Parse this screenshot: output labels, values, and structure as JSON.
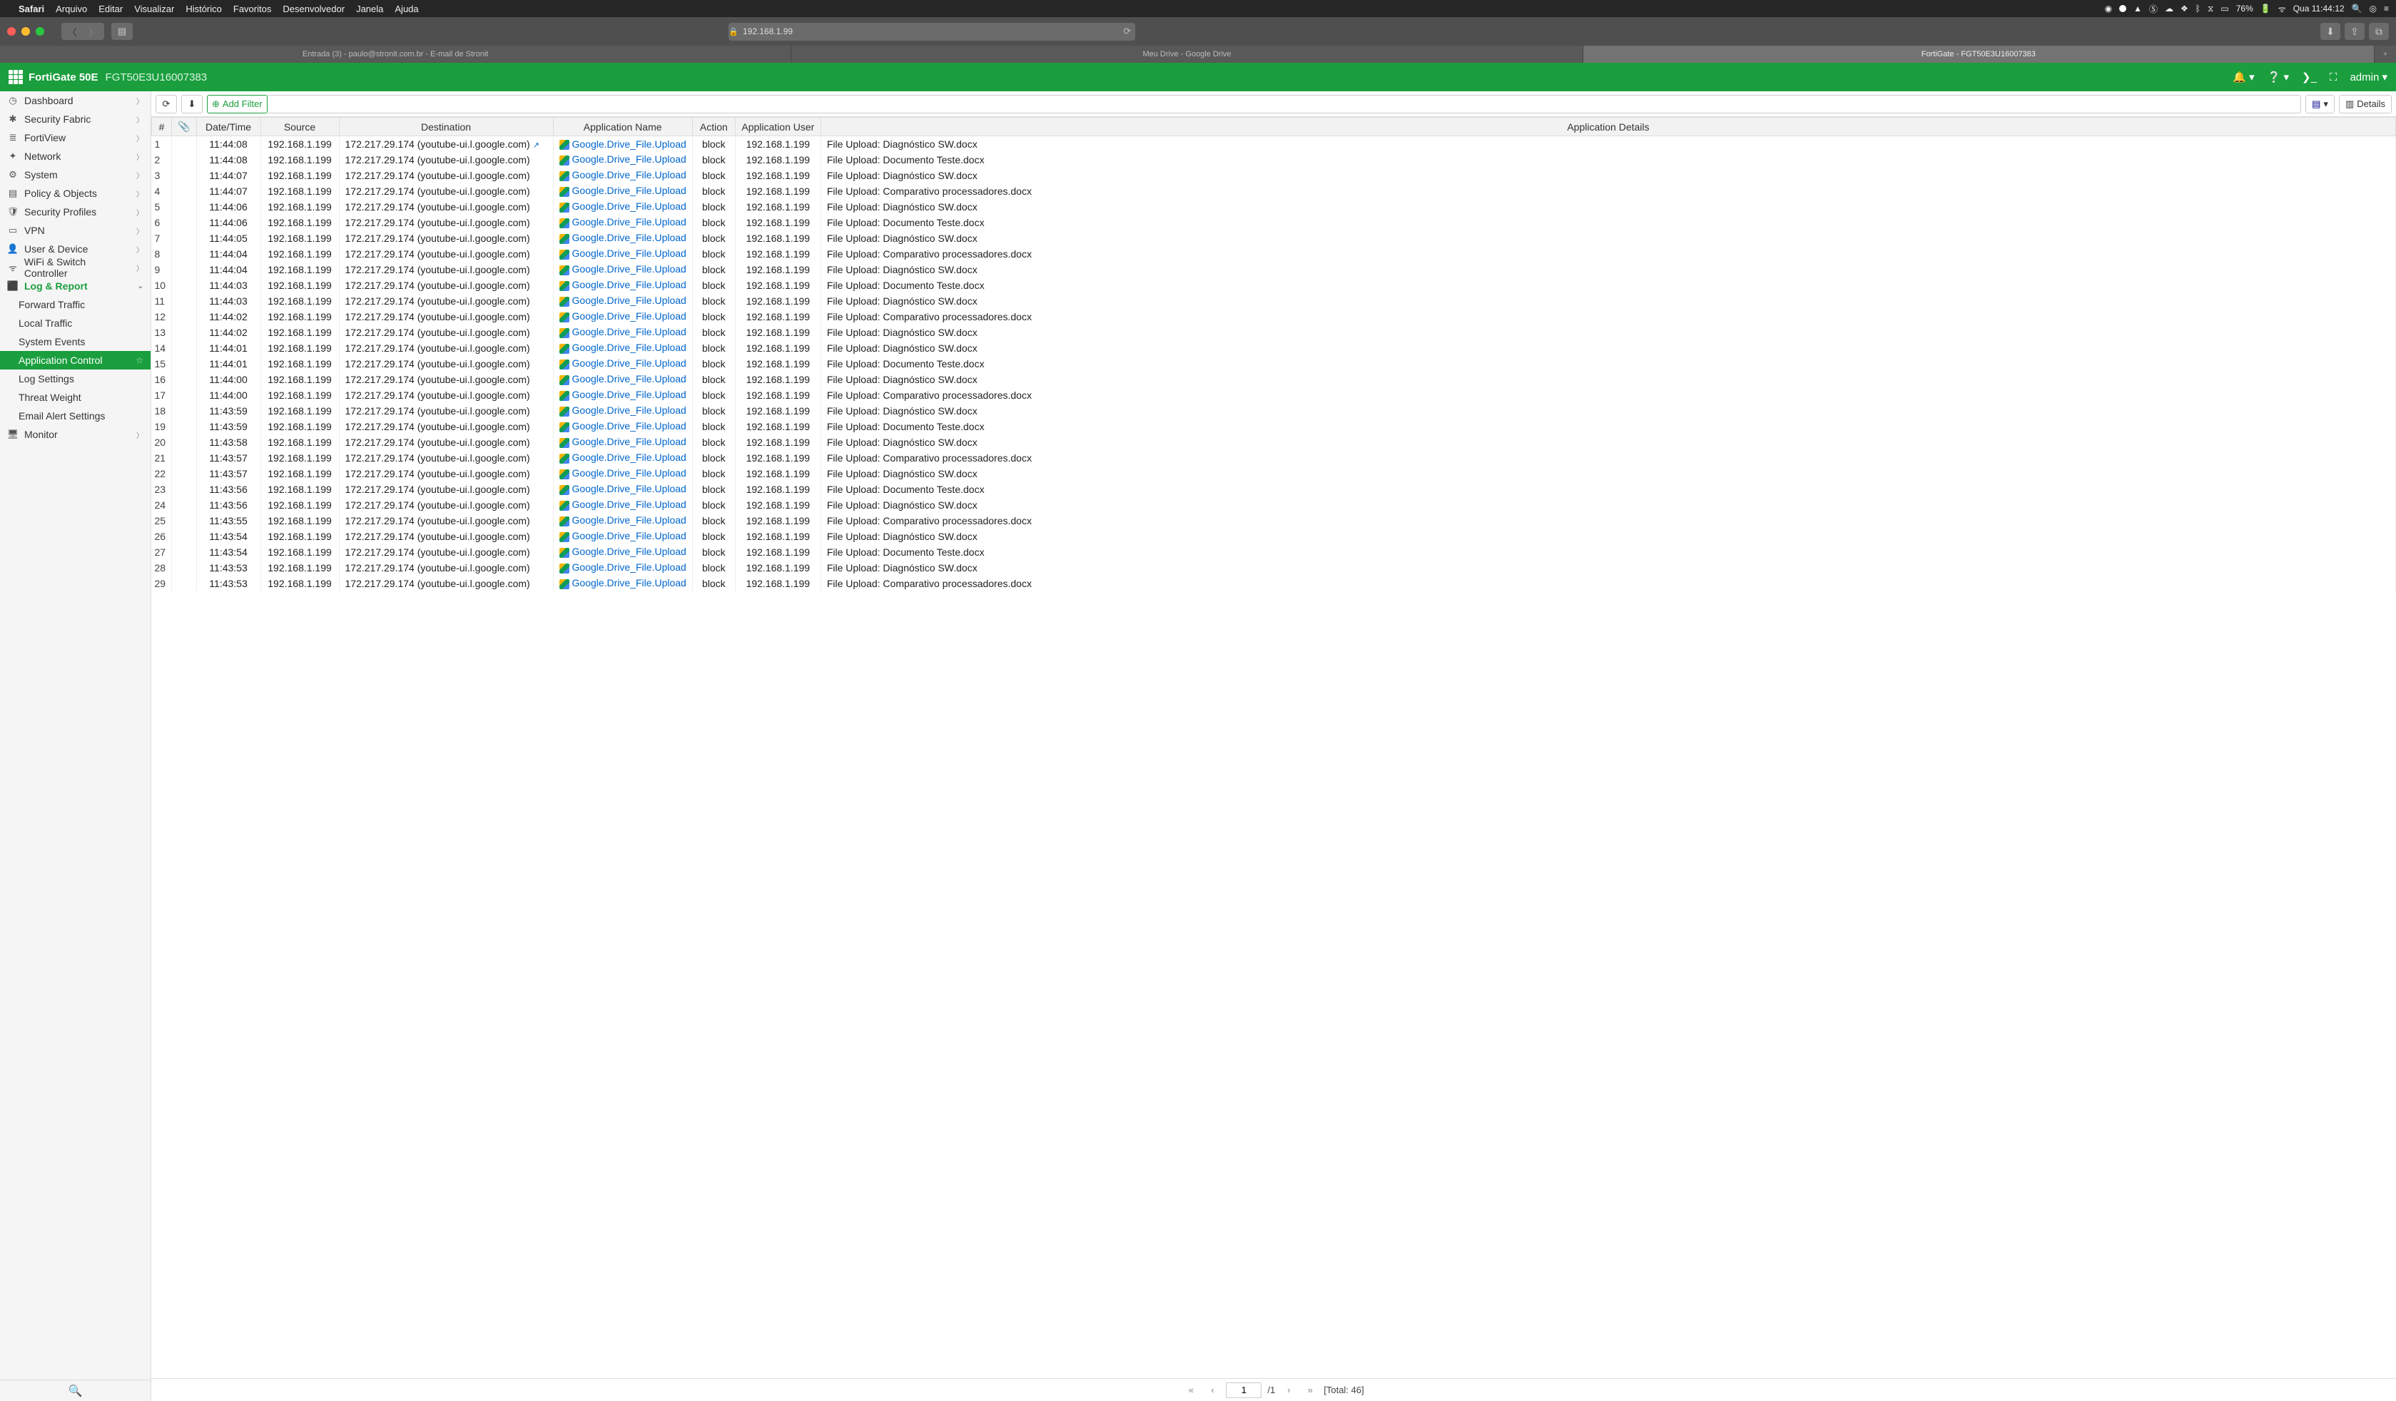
{
  "mac_menu": {
    "app": "Safari",
    "items": [
      "Arquivo",
      "Editar",
      "Visualizar",
      "Histórico",
      "Favoritos",
      "Desenvolvedor",
      "Janela",
      "Ajuda"
    ],
    "battery": "76%",
    "clock": "Qua 11:44:12"
  },
  "url": "192.168.1.99",
  "tabs": {
    "t1": "Entrada (3) - paulo@stronit.com.br - E-mail de Stronit",
    "t2": "Meu Drive - Google Drive",
    "t3": "FortiGate - FGT50E3U16007383"
  },
  "forti": {
    "product": "FortiGate 50E",
    "serial": "FGT50E3U16007383",
    "user": "admin"
  },
  "sidebar": {
    "dashboard": "Dashboard",
    "fabric": "Security Fabric",
    "fortiview": "FortiView",
    "network": "Network",
    "system": "System",
    "policy": "Policy & Objects",
    "secprof": "Security Profiles",
    "vpn": "VPN",
    "userdev": "User & Device",
    "wifi": "WiFi & Switch Controller",
    "log": "Log & Report",
    "forward": "Forward Traffic",
    "local": "Local Traffic",
    "sysev": "System Events",
    "appctrl": "Application Control",
    "logset": "Log Settings",
    "threat": "Threat Weight",
    "email": "Email Alert Settings",
    "monitor": "Monitor"
  },
  "toolbar": {
    "add_filter": "Add Filter",
    "details": "Details"
  },
  "columns": {
    "idx": "#",
    "att": "📎",
    "dt": "Date/Time",
    "src": "Source",
    "dst": "Destination",
    "app": "Application Name",
    "act": "Action",
    "user": "Application User",
    "det": "Application Details"
  },
  "rows": [
    {
      "i": 1,
      "t": "11:44:08",
      "s": "192.168.1.199",
      "d": "172.217.29.174 (youtube-ui.l.google.com)",
      "a": "Google.Drive_File.Upload",
      "ac": "block",
      "u": "192.168.1.199",
      "de": "File Upload: Diagnóstico SW.docx",
      "hl": true
    },
    {
      "i": 2,
      "t": "11:44:08",
      "s": "192.168.1.199",
      "d": "172.217.29.174 (youtube-ui.l.google.com)",
      "a": "Google.Drive_File.Upload",
      "ac": "block",
      "u": "192.168.1.199",
      "de": "File Upload: Documento Teste.docx"
    },
    {
      "i": 3,
      "t": "11:44:07",
      "s": "192.168.1.199",
      "d": "172.217.29.174 (youtube-ui.l.google.com)",
      "a": "Google.Drive_File.Upload",
      "ac": "block",
      "u": "192.168.1.199",
      "de": "File Upload: Diagnóstico SW.docx"
    },
    {
      "i": 4,
      "t": "11:44:07",
      "s": "192.168.1.199",
      "d": "172.217.29.174 (youtube-ui.l.google.com)",
      "a": "Google.Drive_File.Upload",
      "ac": "block",
      "u": "192.168.1.199",
      "de": "File Upload: Comparativo processadores.docx"
    },
    {
      "i": 5,
      "t": "11:44:06",
      "s": "192.168.1.199",
      "d": "172.217.29.174 (youtube-ui.l.google.com)",
      "a": "Google.Drive_File.Upload",
      "ac": "block",
      "u": "192.168.1.199",
      "de": "File Upload: Diagnóstico SW.docx"
    },
    {
      "i": 6,
      "t": "11:44:06",
      "s": "192.168.1.199",
      "d": "172.217.29.174 (youtube-ui.l.google.com)",
      "a": "Google.Drive_File.Upload",
      "ac": "block",
      "u": "192.168.1.199",
      "de": "File Upload: Documento Teste.docx"
    },
    {
      "i": 7,
      "t": "11:44:05",
      "s": "192.168.1.199",
      "d": "172.217.29.174 (youtube-ui.l.google.com)",
      "a": "Google.Drive_File.Upload",
      "ac": "block",
      "u": "192.168.1.199",
      "de": "File Upload: Diagnóstico SW.docx"
    },
    {
      "i": 8,
      "t": "11:44:04",
      "s": "192.168.1.199",
      "d": "172.217.29.174 (youtube-ui.l.google.com)",
      "a": "Google.Drive_File.Upload",
      "ac": "block",
      "u": "192.168.1.199",
      "de": "File Upload: Comparativo processadores.docx"
    },
    {
      "i": 9,
      "t": "11:44:04",
      "s": "192.168.1.199",
      "d": "172.217.29.174 (youtube-ui.l.google.com)",
      "a": "Google.Drive_File.Upload",
      "ac": "block",
      "u": "192.168.1.199",
      "de": "File Upload: Diagnóstico SW.docx"
    },
    {
      "i": 10,
      "t": "11:44:03",
      "s": "192.168.1.199",
      "d": "172.217.29.174 (youtube-ui.l.google.com)",
      "a": "Google.Drive_File.Upload",
      "ac": "block",
      "u": "192.168.1.199",
      "de": "File Upload: Documento Teste.docx"
    },
    {
      "i": 11,
      "t": "11:44:03",
      "s": "192.168.1.199",
      "d": "172.217.29.174 (youtube-ui.l.google.com)",
      "a": "Google.Drive_File.Upload",
      "ac": "block",
      "u": "192.168.1.199",
      "de": "File Upload: Diagnóstico SW.docx"
    },
    {
      "i": 12,
      "t": "11:44:02",
      "s": "192.168.1.199",
      "d": "172.217.29.174 (youtube-ui.l.google.com)",
      "a": "Google.Drive_File.Upload",
      "ac": "block",
      "u": "192.168.1.199",
      "de": "File Upload: Comparativo processadores.docx"
    },
    {
      "i": 13,
      "t": "11:44:02",
      "s": "192.168.1.199",
      "d": "172.217.29.174 (youtube-ui.l.google.com)",
      "a": "Google.Drive_File.Upload",
      "ac": "block",
      "u": "192.168.1.199",
      "de": "File Upload: Diagnóstico SW.docx"
    },
    {
      "i": 14,
      "t": "11:44:01",
      "s": "192.168.1.199",
      "d": "172.217.29.174 (youtube-ui.l.google.com)",
      "a": "Google.Drive_File.Upload",
      "ac": "block",
      "u": "192.168.1.199",
      "de": "File Upload: Diagnóstico SW.docx"
    },
    {
      "i": 15,
      "t": "11:44:01",
      "s": "192.168.1.199",
      "d": "172.217.29.174 (youtube-ui.l.google.com)",
      "a": "Google.Drive_File.Upload",
      "ac": "block",
      "u": "192.168.1.199",
      "de": "File Upload: Documento Teste.docx"
    },
    {
      "i": 16,
      "t": "11:44:00",
      "s": "192.168.1.199",
      "d": "172.217.29.174 (youtube-ui.l.google.com)",
      "a": "Google.Drive_File.Upload",
      "ac": "block",
      "u": "192.168.1.199",
      "de": "File Upload: Diagnóstico SW.docx"
    },
    {
      "i": 17,
      "t": "11:44:00",
      "s": "192.168.1.199",
      "d": "172.217.29.174 (youtube-ui.l.google.com)",
      "a": "Google.Drive_File.Upload",
      "ac": "block",
      "u": "192.168.1.199",
      "de": "File Upload: Comparativo processadores.docx"
    },
    {
      "i": 18,
      "t": "11:43:59",
      "s": "192.168.1.199",
      "d": "172.217.29.174 (youtube-ui.l.google.com)",
      "a": "Google.Drive_File.Upload",
      "ac": "block",
      "u": "192.168.1.199",
      "de": "File Upload: Diagnóstico SW.docx"
    },
    {
      "i": 19,
      "t": "11:43:59",
      "s": "192.168.1.199",
      "d": "172.217.29.174 (youtube-ui.l.google.com)",
      "a": "Google.Drive_File.Upload",
      "ac": "block",
      "u": "192.168.1.199",
      "de": "File Upload: Documento Teste.docx"
    },
    {
      "i": 20,
      "t": "11:43:58",
      "s": "192.168.1.199",
      "d": "172.217.29.174 (youtube-ui.l.google.com)",
      "a": "Google.Drive_File.Upload",
      "ac": "block",
      "u": "192.168.1.199",
      "de": "File Upload: Diagnóstico SW.docx"
    },
    {
      "i": 21,
      "t": "11:43:57",
      "s": "192.168.1.199",
      "d": "172.217.29.174 (youtube-ui.l.google.com)",
      "a": "Google.Drive_File.Upload",
      "ac": "block",
      "u": "192.168.1.199",
      "de": "File Upload: Comparativo processadores.docx"
    },
    {
      "i": 22,
      "t": "11:43:57",
      "s": "192.168.1.199",
      "d": "172.217.29.174 (youtube-ui.l.google.com)",
      "a": "Google.Drive_File.Upload",
      "ac": "block",
      "u": "192.168.1.199",
      "de": "File Upload: Diagnóstico SW.docx"
    },
    {
      "i": 23,
      "t": "11:43:56",
      "s": "192.168.1.199",
      "d": "172.217.29.174 (youtube-ui.l.google.com)",
      "a": "Google.Drive_File.Upload",
      "ac": "block",
      "u": "192.168.1.199",
      "de": "File Upload: Documento Teste.docx"
    },
    {
      "i": 24,
      "t": "11:43:56",
      "s": "192.168.1.199",
      "d": "172.217.29.174 (youtube-ui.l.google.com)",
      "a": "Google.Drive_File.Upload",
      "ac": "block",
      "u": "192.168.1.199",
      "de": "File Upload: Diagnóstico SW.docx"
    },
    {
      "i": 25,
      "t": "11:43:55",
      "s": "192.168.1.199",
      "d": "172.217.29.174 (youtube-ui.l.google.com)",
      "a": "Google.Drive_File.Upload",
      "ac": "block",
      "u": "192.168.1.199",
      "de": "File Upload: Comparativo processadores.docx"
    },
    {
      "i": 26,
      "t": "11:43:54",
      "s": "192.168.1.199",
      "d": "172.217.29.174 (youtube-ui.l.google.com)",
      "a": "Google.Drive_File.Upload",
      "ac": "block",
      "u": "192.168.1.199",
      "de": "File Upload: Diagnóstico SW.docx"
    },
    {
      "i": 27,
      "t": "11:43:54",
      "s": "192.168.1.199",
      "d": "172.217.29.174 (youtube-ui.l.google.com)",
      "a": "Google.Drive_File.Upload",
      "ac": "block",
      "u": "192.168.1.199",
      "de": "File Upload: Documento Teste.docx"
    },
    {
      "i": 28,
      "t": "11:43:53",
      "s": "192.168.1.199",
      "d": "172.217.29.174 (youtube-ui.l.google.com)",
      "a": "Google.Drive_File.Upload",
      "ac": "block",
      "u": "192.168.1.199",
      "de": "File Upload: Diagnóstico SW.docx"
    },
    {
      "i": 29,
      "t": "11:43:53",
      "s": "192.168.1.199",
      "d": "172.217.29.174 (youtube-ui.l.google.com)",
      "a": "Google.Drive_File.Upload",
      "ac": "block",
      "u": "192.168.1.199",
      "de": "File Upload: Comparativo processadores.docx"
    }
  ],
  "pager": {
    "page": "1",
    "pages": "/1",
    "total": "[Total: 46]"
  }
}
